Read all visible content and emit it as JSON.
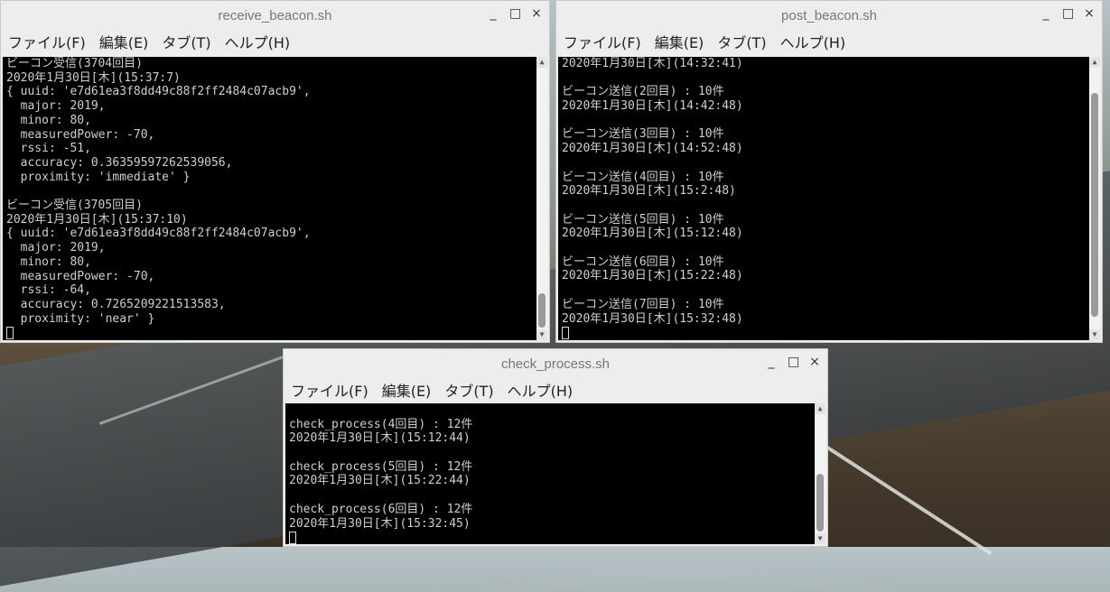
{
  "menu": [
    "ファイル(F)",
    "編集(E)",
    "タブ(T)",
    "ヘルプ(H)"
  ],
  "window_controls": [
    "_",
    "□",
    "×"
  ],
  "windows": {
    "receive": {
      "title": "receive_beacon.sh",
      "lines": [
        "ビーコン受信(3704回目)",
        "2020年1月30日[木](15:37:7)",
        "{ uuid: 'e7d61ea3f8dd49c88f2ff2484c07acb9',",
        "  major: 2019,",
        "  minor: 80,",
        "  measuredPower: -70,",
        "  rssi: -51,",
        "  accuracy: 0.36359597262539056,",
        "  proximity: 'immediate' }",
        "",
        "ビーコン受信(3705回目)",
        "2020年1月30日[木](15:37:10)",
        "{ uuid: 'e7d61ea3f8dd49c88f2ff2484c07acb9',",
        "  major: 2019,",
        "  minor: 80,",
        "  measuredPower: -70,",
        "  rssi: -64,",
        "  accuracy: 0.7265209221513583,",
        "  proximity: 'near' }"
      ]
    },
    "post": {
      "title": "post_beacon.sh",
      "lines": [
        "2020年1月30日[木](14:32:41)",
        "",
        "ビーコン送信(2回目) : 10件",
        "2020年1月30日[木](14:42:48)",
        "",
        "ビーコン送信(3回目) : 10件",
        "2020年1月30日[木](14:52:48)",
        "",
        "ビーコン送信(4回目) : 10件",
        "2020年1月30日[木](15:2:48)",
        "",
        "ビーコン送信(5回目) : 10件",
        "2020年1月30日[木](15:12:48)",
        "",
        "ビーコン送信(6回目) : 10件",
        "2020年1月30日[木](15:22:48)",
        "",
        "ビーコン送信(7回目) : 10件",
        "2020年1月30日[木](15:32:48)"
      ]
    },
    "check": {
      "title": "check_process.sh",
      "lines": [
        "",
        "check_process(4回目) : 12件",
        "2020年1月30日[木](15:12:44)",
        "",
        "check_process(5回目) : 12件",
        "2020年1月30日[木](15:22:44)",
        "",
        "check_process(6回目) : 12件",
        "2020年1月30日[木](15:32:45)"
      ]
    }
  }
}
